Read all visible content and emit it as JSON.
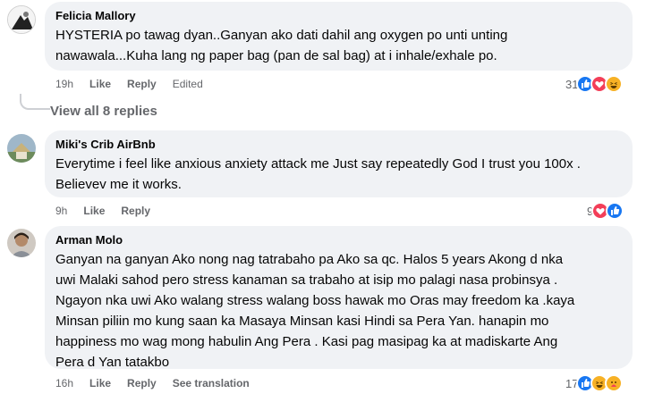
{
  "comments": [
    {
      "author": "Felicia Mallory",
      "text_lines": [
        "HYSTERIA po tawag dyan..Ganyan ako dati dahil ang oxygen po unti unting",
        "nawawala...Kuha lang ng paper bag (pan de sal bag) at i inhale/exhale po."
      ],
      "time": "19h",
      "like": "Like",
      "reply": "Reply",
      "extra": "Edited",
      "reaction_count": "31",
      "reactions": [
        "like-icon",
        "love-icon",
        "haha-icon"
      ]
    },
    {
      "author": "Miki's Crib AirBnb",
      "text_lines": [
        "Everytime i feel like anxious anxiety attack me Just say repeatedly God I trust you 100x .",
        "Believev me it works."
      ],
      "time": "9h",
      "like": "Like",
      "reply": "Reply",
      "reaction_count": "9",
      "reactions": [
        "love-icon",
        "like-icon"
      ]
    },
    {
      "author": "Arman Molo",
      "text_lines": [
        "Ganyan na ganyan Ako nong nag tatrabaho pa Ako sa qc. Halos 5 years Akong d nka",
        "uwi Malaki sahod pero stress kanaman sa trabaho at isip mo palagi nasa probinsya .",
        "Ngayon nka uwi Ako walang stress walang boss hawak mo Oras may freedom ka .kaya",
        "Minsan piliin mo kung saan ka Masaya Minsan kasi Hindi sa Pera Yan. hanapin mo",
        "happiness mo wag mong habulin Ang Pera . Kasi pag masipag ka at madiskarte Ang",
        "Pera d Yan tatakbo"
      ],
      "time": "16h",
      "like": "Like",
      "reply": "Reply",
      "extra": "See translation",
      "reaction_count": "17",
      "reactions": [
        "like-icon",
        "haha-icon",
        "care-icon"
      ]
    }
  ],
  "view_replies": "View all 8 replies",
  "colors": {
    "like": "#1877f2",
    "love": "#f33e58",
    "haha": "#f7b125",
    "bubble": "#f0f2f5",
    "meta": "#65676b"
  }
}
